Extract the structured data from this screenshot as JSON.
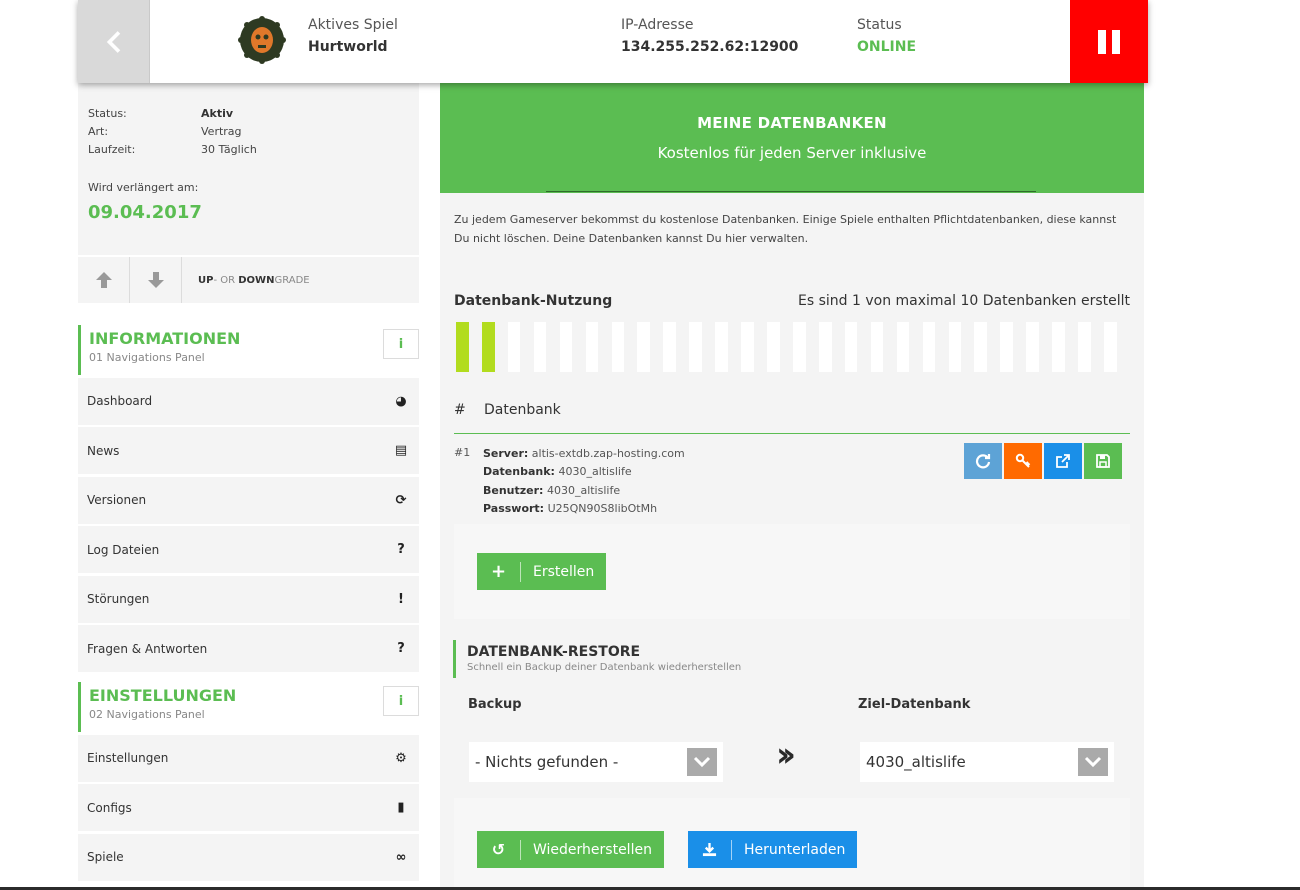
{
  "header": {
    "active_game_label": "Aktives Spiel",
    "active_game_value": "Hurtworld",
    "ip_label": "IP-Adresse",
    "ip_value": "134.255.252.62:12900",
    "status_label": "Status",
    "status_value": "ONLINE",
    "status_color": "#5bbd52",
    "pause_color": "#ff0000"
  },
  "sidebar": {
    "info": [
      {
        "key": "Status:",
        "value": "Aktiv"
      },
      {
        "key": "Art:",
        "value": "Vertrag"
      },
      {
        "key": "Laufzeit:",
        "value": "30 Täglich"
      }
    ],
    "renew_label": "Wird verlängert am:",
    "renew_date": "09.04.2017",
    "updown_up": "UP",
    "updown_or": "- OR ",
    "updown_down": "DOWN",
    "updown_grade": "GRADE",
    "sections": [
      {
        "title": "INFORMATIONEN",
        "subtitle": "01 Navigations Panel",
        "info_icon": "i",
        "items": [
          {
            "label": "Dashboard",
            "icon": "dashboard-icon"
          },
          {
            "label": "News",
            "icon": "newspaper-icon"
          },
          {
            "label": "Versionen",
            "icon": "refresh-icon"
          },
          {
            "label": "Log Dateien",
            "icon": "question-icon"
          },
          {
            "label": "Störungen",
            "icon": "exclamation-icon"
          },
          {
            "label": "Fragen & Antworten",
            "icon": "question-icon"
          }
        ]
      },
      {
        "title": "EINSTELLUNGEN",
        "subtitle": "02 Navigations Panel",
        "info_icon": "i",
        "items": [
          {
            "label": "Einstellungen",
            "icon": "gears-icon"
          },
          {
            "label": "Configs",
            "icon": "file-icon"
          },
          {
            "label": "Spiele",
            "icon": "gamepad-icon"
          }
        ]
      }
    ]
  },
  "main": {
    "banner_title": "MEINE DATENBANKEN",
    "banner_subtitle": "Kostenlos für jeden Server inklusive",
    "intro": "Zu jedem Gameserver bekommst du kostenlose Datenbanken. Einige Spiele enthalten Pflichtdatenbanken, diese kannst Du nicht löschen. Deine Datenbanken kannst Du hier verwalten.",
    "usage_title": "Datenbank-Nutzung",
    "usage_text": "Es sind 1 von maximal 10 Datenbanken erstellt",
    "usage_used": 2,
    "usage_total": 26,
    "table_col_num": "#",
    "table_col_db": "Datenbank",
    "databases": [
      {
        "num": "#1",
        "server_label": "Server:",
        "server": "altis-extdb.zap-hosting.com",
        "db_label": "Datenbank:",
        "db": "4030_altislife",
        "user_label": "Benutzer:",
        "user": "4030_altislife",
        "pass_label": "Passwort:",
        "pass": "U25QN90S8libOtMh"
      }
    ],
    "create_label": "Erstellen",
    "restore_title": "DATENBANK-RESTORE",
    "restore_subtitle": "Schnell ein Backup deiner Datenbank wiederherstellen",
    "backup_label": "Backup",
    "backup_value": "- Nichts gefunden -",
    "target_label": "Ziel-Datenbank",
    "target_value": "4030_altislife",
    "restore_button": "Wiederherstellen",
    "download_button": "Herunterladen"
  }
}
